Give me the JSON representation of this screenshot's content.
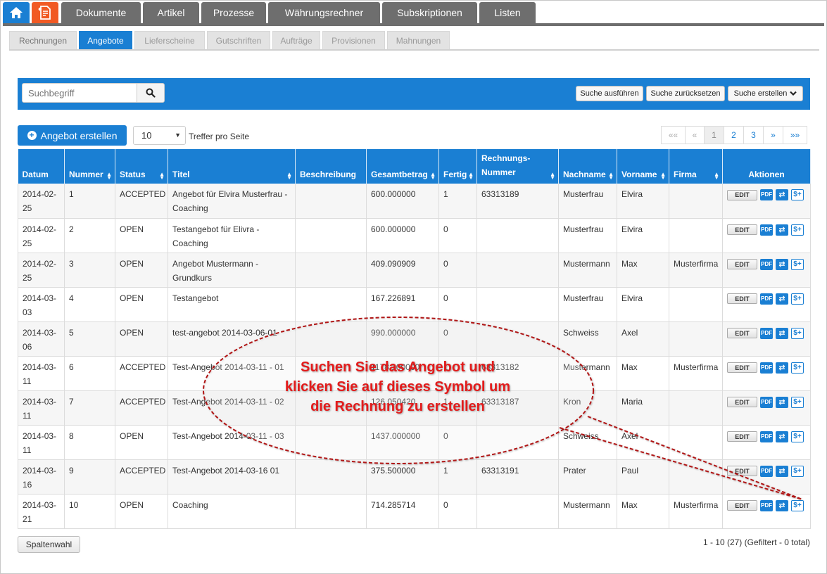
{
  "main_tabs": [
    "Dokumente",
    "Artikel",
    "Prozesse",
    "Währungsrechner",
    "Subskriptionen",
    "Listen"
  ],
  "sub_tabs": [
    "Rechnungen",
    "Angebote",
    "Lieferscheine",
    "Gutschriften",
    "Aufträge",
    "Provisionen",
    "Mahnungen"
  ],
  "active_sub_tab": "Angebote",
  "search": {
    "placeholder": "Suchbegriff",
    "run_label": "Suche ausführen",
    "reset_label": "Suche zurücksetzen",
    "create_label": "Suche erstellen"
  },
  "toolbar": {
    "create_label": "Angebot erstellen",
    "page_size": "10",
    "per_page_label": "Treffer pro Seite"
  },
  "pager": [
    "««",
    "«",
    "1",
    "2",
    "3",
    "»",
    "»»"
  ],
  "columns": [
    "Datum",
    "Nummer",
    "Status",
    "Titel",
    "Beschreibung",
    "Gesamtbetrag",
    "Fertig",
    "Rechnungs-Nummer",
    "Nachname",
    "Vorname",
    "Firma",
    "Aktionen"
  ],
  "actions": {
    "edit": "EDIT",
    "pdf": "PDF"
  },
  "rows": [
    {
      "datum": "2014-02-25",
      "nummer": "1",
      "status": "ACCEPTED",
      "titel": "Angebot für Elvira Musterfrau - Coaching",
      "beschreibung": "",
      "betrag": "600.000000",
      "fertig": "1",
      "rechnungsnummer": "63313189",
      "nachname": "Musterfrau",
      "vorname": "Elvira",
      "firma": ""
    },
    {
      "datum": "2014-02-25",
      "nummer": "2",
      "status": "OPEN",
      "titel": "Testangebot für Elivra - Coaching",
      "beschreibung": "",
      "betrag": "600.000000",
      "fertig": "0",
      "rechnungsnummer": "",
      "nachname": "Musterfrau",
      "vorname": "Elvira",
      "firma": ""
    },
    {
      "datum": "2014-02-25",
      "nummer": "3",
      "status": "OPEN",
      "titel": "Angebot Mustermann - Grundkurs",
      "beschreibung": "",
      "betrag": "409.090909",
      "fertig": "0",
      "rechnungsnummer": "",
      "nachname": "Mustermann",
      "vorname": "Max",
      "firma": "Musterfirma"
    },
    {
      "datum": "2014-03-03",
      "nummer": "4",
      "status": "OPEN",
      "titel": "Testangebot",
      "beschreibung": "",
      "betrag": "167.226891",
      "fertig": "0",
      "rechnungsnummer": "",
      "nachname": "Musterfrau",
      "vorname": "Elvira",
      "firma": ""
    },
    {
      "datum": "2014-03-06",
      "nummer": "5",
      "status": "OPEN",
      "titel": "test-angebot 2014-03-06-01",
      "beschreibung": "",
      "betrag": "990.000000",
      "fertig": "0",
      "rechnungsnummer": "",
      "nachname": "Schweiss",
      "vorname": "Axel",
      "firma": ""
    },
    {
      "datum": "2014-03-11",
      "nummer": "6",
      "status": "ACCEPTED",
      "titel": "Test-Angebot 2014-03-11 - 01",
      "beschreibung": "",
      "betrag": "1178.100000",
      "fertig": "1",
      "rechnungsnummer": "63313182",
      "nachname": "Mustermann",
      "vorname": "Max",
      "firma": "Musterfirma"
    },
    {
      "datum": "2014-03-11",
      "nummer": "7",
      "status": "ACCEPTED",
      "titel": "Test-Angebot 2014-03-11 - 02",
      "beschreibung": "",
      "betrag": "126.050420",
      "fertig": "1",
      "rechnungsnummer": "63313187",
      "nachname": "Kron",
      "vorname": "Maria",
      "firma": ""
    },
    {
      "datum": "2014-03-11",
      "nummer": "8",
      "status": "OPEN",
      "titel": "Test-Angebot 2014-03-11 - 03",
      "beschreibung": "",
      "betrag": "1437.000000",
      "fertig": "0",
      "rechnungsnummer": "",
      "nachname": "Schweiss",
      "vorname": "Axel",
      "firma": ""
    },
    {
      "datum": "2014-03-16",
      "nummer": "9",
      "status": "ACCEPTED",
      "titel": "Test-Angebot 2014-03-16 01",
      "beschreibung": "",
      "betrag": "375.500000",
      "fertig": "1",
      "rechnungsnummer": "63313191",
      "nachname": "Prater",
      "vorname": "Paul",
      "firma": ""
    },
    {
      "datum": "2014-03-21",
      "nummer": "10",
      "status": "OPEN",
      "titel": "Coaching",
      "beschreibung": "",
      "betrag": "714.285714",
      "fertig": "0",
      "rechnungsnummer": "",
      "nachname": "Mustermann",
      "vorname": "Max",
      "firma": "Musterfirma"
    }
  ],
  "footer": {
    "column_choice_label": "Spaltenwahl",
    "total_text": "1 - 10 (27) (Gefiltert - 0 total)"
  },
  "annotation": {
    "lines": [
      "Suchen Sie das Angebot und",
      "klicken Sie auf dieses Symbol um",
      "die Rechnung zu erstellen"
    ]
  },
  "colors": {
    "primary": "#1a7fd3",
    "nav_gray": "#6e6e6e",
    "home_brand": "#f15a24",
    "annotation_red": "#e31b1b"
  }
}
